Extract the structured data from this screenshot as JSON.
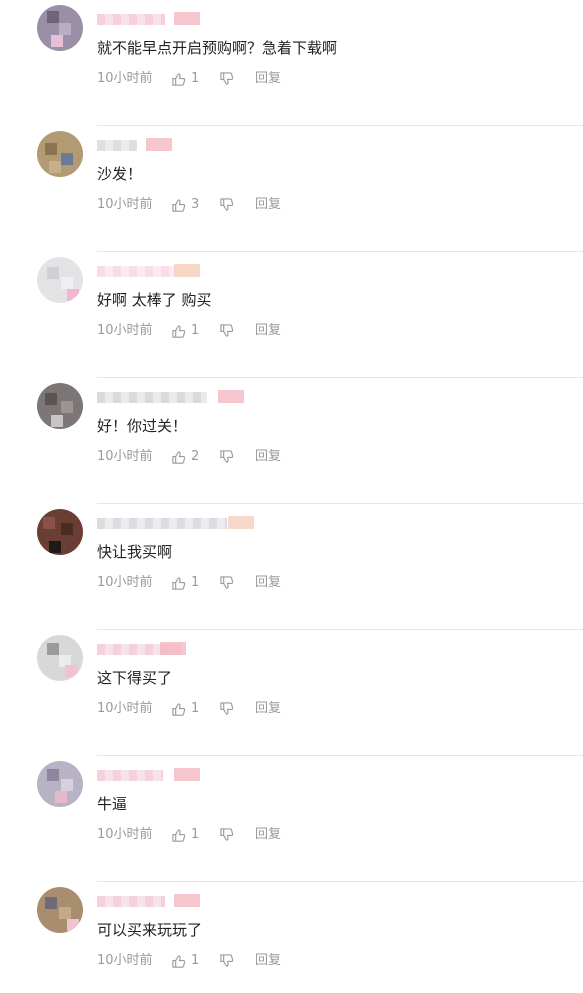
{
  "comments": [
    {
      "text": "就不能早点开启预购啊？急着下载啊",
      "time": "10小时前",
      "likes": "1",
      "reply": "回复"
    },
    {
      "text": "沙发！",
      "time": "10小时前",
      "likes": "3",
      "reply": "回复"
    },
    {
      "text": "好啊 太棒了 购买",
      "time": "10小时前",
      "likes": "1",
      "reply": "回复"
    },
    {
      "text": "好！你过关！",
      "time": "10小时前",
      "likes": "2",
      "reply": "回复"
    },
    {
      "text": "快让我买啊",
      "time": "10小时前",
      "likes": "1",
      "reply": "回复"
    },
    {
      "text": "这下得买了",
      "time": "10小时前",
      "likes": "1",
      "reply": "回复"
    },
    {
      "text": "牛逼",
      "time": "10小时前",
      "likes": "1",
      "reply": "回复"
    },
    {
      "text": "可以买来玩玩了",
      "time": "10小时前",
      "likes": "1",
      "reply": "回复"
    }
  ],
  "icons": {
    "like": "thumbs-up-icon",
    "dislike": "thumbs-down-icon"
  },
  "colors": {
    "text": "#222222",
    "meta": "#9a9a9a",
    "divider": "#e6e6e6"
  }
}
